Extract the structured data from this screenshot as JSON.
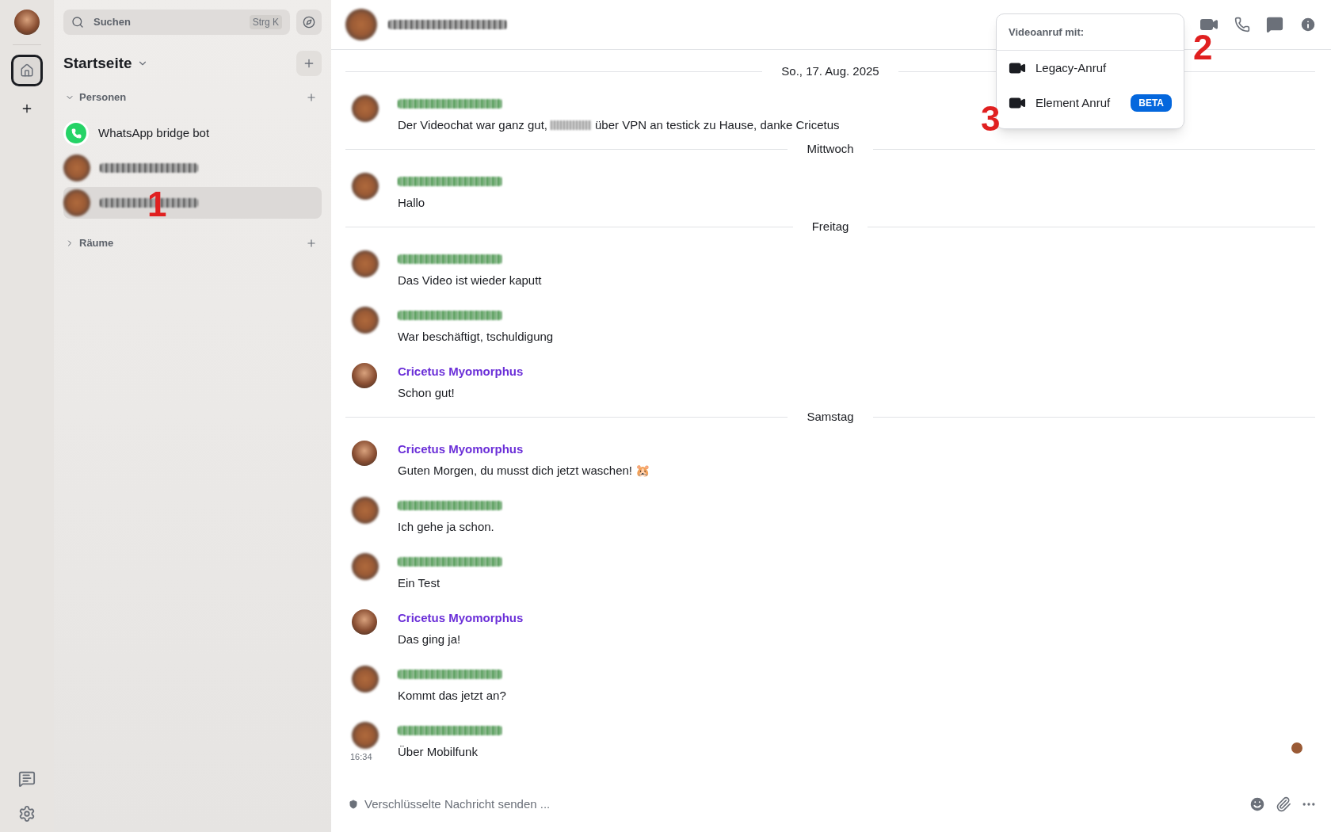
{
  "spaces_rail": {
    "items": [
      {
        "kind": "home",
        "selected": true
      },
      {
        "kind": "add",
        "selected": false
      }
    ]
  },
  "sidebar": {
    "search": {
      "placeholder": "Suchen",
      "shortcut": "Strg K"
    },
    "title": "Startseite",
    "sections": [
      {
        "label": "Personen",
        "expanded": true,
        "items": [
          {
            "kind": "whatsapp",
            "name": "WhatsApp bridge bot",
            "selected": false
          },
          {
            "kind": "hidden",
            "selected": false
          },
          {
            "kind": "hidden",
            "selected": true
          }
        ]
      },
      {
        "label": "Räume",
        "expanded": false
      }
    ]
  },
  "room_header": {
    "video_menu": {
      "title": "Videoanruf mit:",
      "options": [
        {
          "label": "Legacy-Anruf"
        },
        {
          "label": "Element Anruf",
          "badge": "BETA"
        }
      ]
    }
  },
  "timeline": [
    {
      "kind": "date",
      "label": "So., 17. Aug. 2025"
    },
    {
      "kind": "message",
      "parts": [
        "Der Videochat war ganz gut,",
        "über VPN an testick zu Hause, danke Cricetus"
      ]
    },
    {
      "kind": "date",
      "label": "Mittwoch"
    },
    {
      "kind": "message",
      "parts": [
        "Hallo"
      ]
    },
    {
      "kind": "date",
      "label": "Freitag"
    },
    {
      "kind": "message",
      "parts": [
        "Das Video ist wieder kaputt"
      ]
    },
    {
      "kind": "message",
      "parts": [
        "War beschäftigt, tschuldigung"
      ]
    },
    {
      "kind": "message",
      "sender": "Cricetus Myomorphus",
      "parts": [
        "Schon gut!"
      ]
    },
    {
      "kind": "date",
      "label": "Samstag"
    },
    {
      "kind": "message",
      "sender": "Cricetus Myomorphus",
      "parts": [
        "Guten Morgen, du musst dich jetzt waschen! 🐹"
      ]
    },
    {
      "kind": "message",
      "parts": [
        "Ich gehe ja schon."
      ]
    },
    {
      "kind": "message",
      "parts": [
        "Ein Test"
      ]
    },
    {
      "kind": "message",
      "sender": "Cricetus Myomorphus",
      "parts": [
        "Das ging ja!"
      ]
    },
    {
      "kind": "message",
      "parts": [
        "Kommt das jetzt an?"
      ]
    },
    {
      "kind": "message",
      "parts": [
        "Über Mobilfunk"
      ],
      "time": "16:34",
      "read_receipt": true
    }
  ],
  "composer": {
    "placeholder": "Verschlüsselte Nachricht senden ..."
  },
  "annotations": [
    {
      "label": "1"
    },
    {
      "label": "2"
    },
    {
      "label": "3"
    }
  ]
}
